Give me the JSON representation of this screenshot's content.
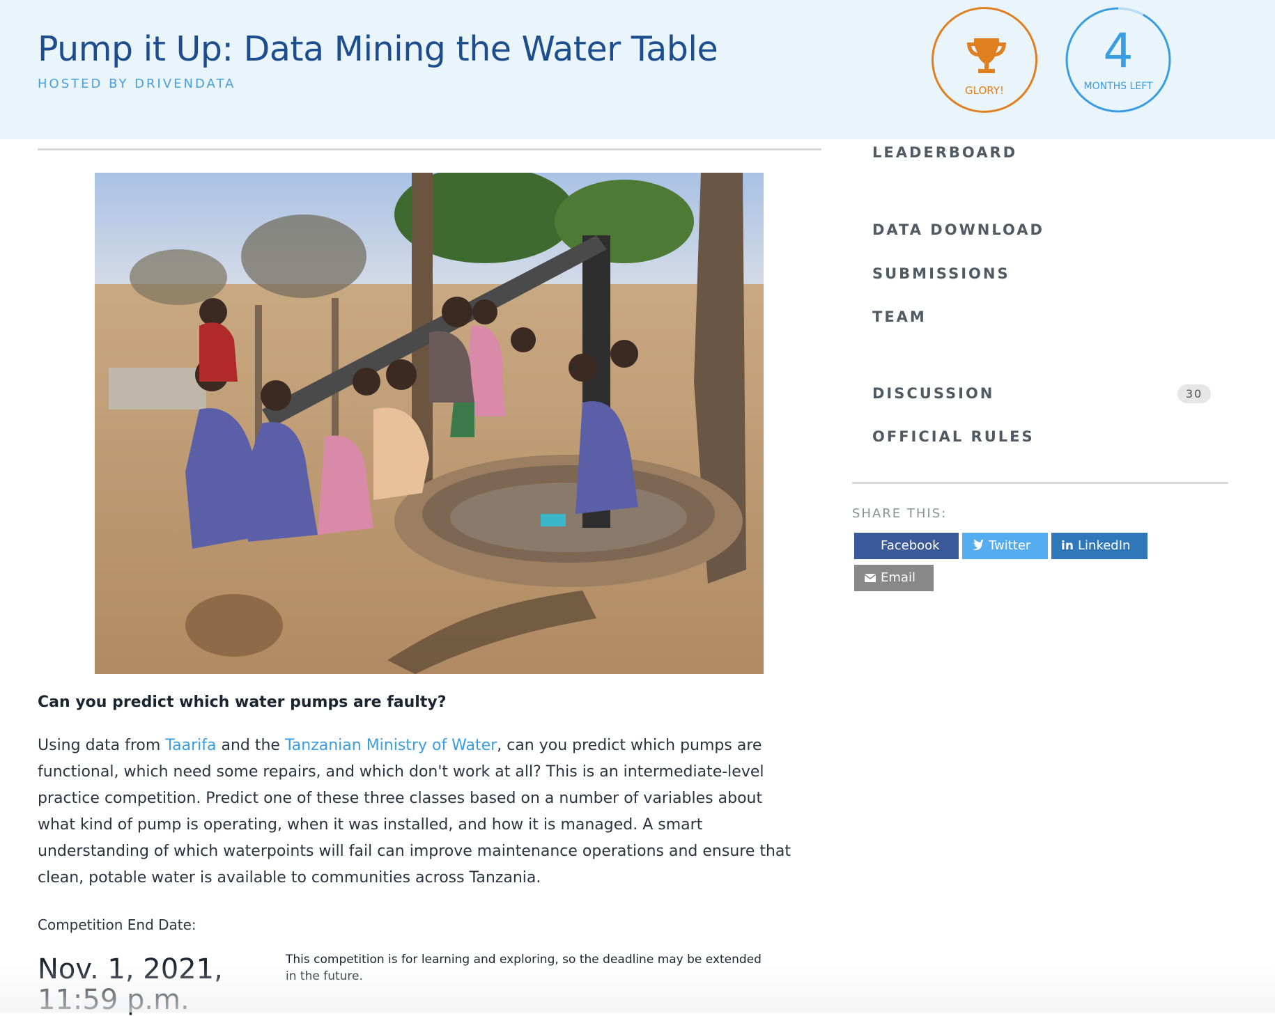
{
  "header": {
    "title": "Pump it Up: Data Mining the Water Table",
    "host": "HOSTED BY DRIVENDATA",
    "glory_label": "GLORY!",
    "months_number": "4",
    "months_label": "MONTHS LEFT",
    "months_progress_fraction": 0.08,
    "glory_icon": "trophy-icon",
    "colors": {
      "brand_blue": "#1d4d8c",
      "accent_blue": "#3a9de2",
      "glory_orange": "#e07f1f",
      "header_bg": "#e9f4fb"
    }
  },
  "main": {
    "photo_description_icon": "photo-children-water-pump",
    "question": "Can you predict which water pumps are faulty?",
    "para_prefix": "Using data from ",
    "link_taarifa": "Taarifa",
    "para_mid": " and the ",
    "link_ministry": "Tanzanian Ministry of Water",
    "para_suffix": ", can you predict which pumps are functional, which need some repairs, and which don't work at all? This is an intermediate-level practice competition. Predict one of these three classes based on a number of variables about what kind of pump is operating, when it was installed, and how it is managed. A smart understanding of which waterpoints will fail can improve maintenance operations and ensure that clean, potable water is available to communities across Tanzania.",
    "end_label": "Competition End Date:",
    "end_date": "Nov. 1, 2021, 11:59 p.m.",
    "end_note": "This competition is for learning and exploring, so the deadline may be extended in the future."
  },
  "sidebar": {
    "nav": {
      "leaderboard": "LEADERBOARD",
      "data_download": "DATA DOWNLOAD",
      "submissions": "SUBMISSIONS",
      "team": "TEAM",
      "discussion": "DISCUSSION",
      "discussion_count": "30",
      "official_rules": "OFFICIAL RULES"
    },
    "share_label": "SHARE THIS:",
    "share": {
      "facebook": "Facebook",
      "twitter": "Twitter",
      "linkedin": "LinkedIn",
      "email": "Email"
    },
    "share_colors": {
      "facebook": "#3b5998",
      "twitter": "#55acee",
      "linkedin": "#2f77b8",
      "email": "#888888"
    }
  }
}
